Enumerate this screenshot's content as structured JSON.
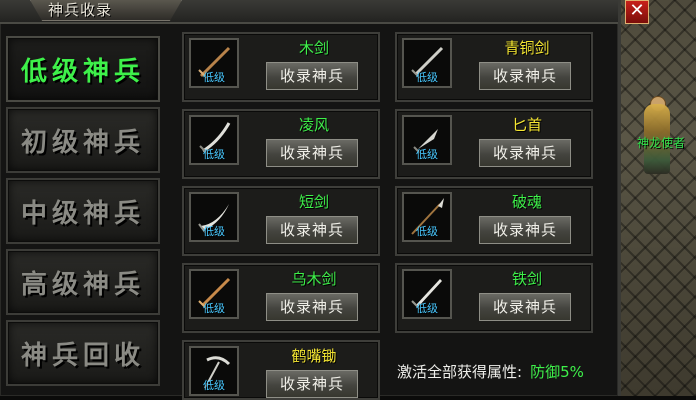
{
  "window": {
    "title": "神兵收录",
    "close_label": "✕"
  },
  "tabs": [
    {
      "label": "低级神兵",
      "active": true
    },
    {
      "label": "初级神兵",
      "active": false
    },
    {
      "label": "中级神兵",
      "active": false
    },
    {
      "label": "高级神兵",
      "active": false
    },
    {
      "label": "神兵回收",
      "active": false
    }
  ],
  "items": [
    {
      "name": "木剑",
      "name_color": "green",
      "grade": "低级",
      "button": "收录神兵",
      "icon": "wooden-sword-icon"
    },
    {
      "name": "青铜剑",
      "name_color": "yellow",
      "grade": "低级",
      "button": "收录神兵",
      "icon": "bronze-sword-icon"
    },
    {
      "name": "凌风",
      "name_color": "green",
      "grade": "低级",
      "button": "收录神兵",
      "icon": "saber-icon"
    },
    {
      "name": "匕首",
      "name_color": "yellow",
      "grade": "低级",
      "button": "收录神兵",
      "icon": "dagger-icon"
    },
    {
      "name": "短剑",
      "name_color": "green",
      "grade": "低级",
      "button": "收录神兵",
      "icon": "short-sword-icon"
    },
    {
      "name": "破魂",
      "name_color": "green",
      "grade": "低级",
      "button": "收录神兵",
      "icon": "spear-icon"
    },
    {
      "name": "乌木剑",
      "name_color": "green",
      "grade": "低级",
      "button": "收录神兵",
      "icon": "ebony-sword-icon"
    },
    {
      "name": "铁剑",
      "name_color": "green",
      "grade": "低级",
      "button": "收录神兵",
      "icon": "iron-sword-icon"
    },
    {
      "name": "鹤嘴锄",
      "name_color": "yellow",
      "grade": "低级",
      "button": "收录神兵",
      "icon": "pickaxe-icon"
    }
  ],
  "summary": {
    "label": "激活全部获得属性:",
    "value": "防御5%"
  },
  "world": {
    "npc_name": "神龙使者"
  },
  "colors": {
    "active_tab": "#3ef04a",
    "grade": "#48c8ff",
    "green_name": "#3ef04a",
    "yellow_name": "#f5e632"
  }
}
